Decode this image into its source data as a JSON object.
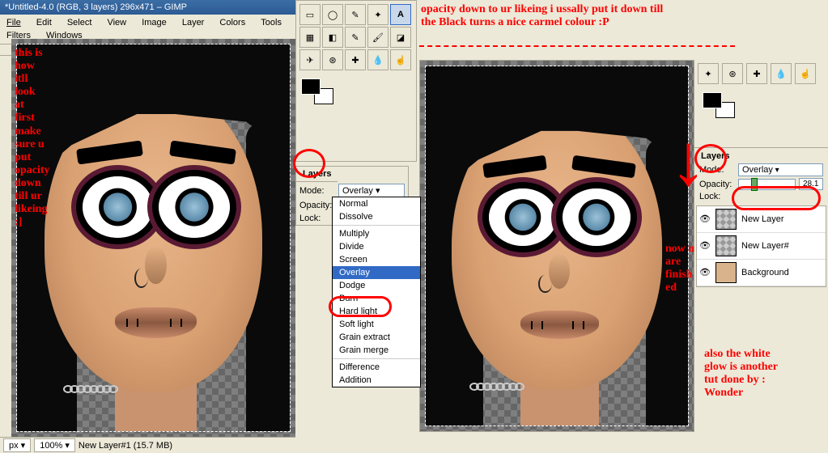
{
  "window": {
    "title": "*Untitled-4.0 (RGB, 3 layers) 296x471 – GIMP"
  },
  "menubar": {
    "items": [
      "File",
      "Edit",
      "Select",
      "View",
      "Image",
      "Layer",
      "Colors",
      "Tools",
      "Filters",
      "Windows"
    ]
  },
  "statusbar": {
    "unit": "px",
    "zoom": "100%",
    "layer": "New Layer#1 (15.7 MB)"
  },
  "layers_mid": {
    "tab": "Layers",
    "mode_label": "Mode:",
    "mode_value": "Overlay",
    "opacity_label": "Opacity:",
    "lock_label": "Lock:"
  },
  "mode_options": [
    "Normal",
    "Dissolve",
    "",
    "Multiply",
    "Divide",
    "Screen",
    "Overlay",
    "Dodge",
    "Burn",
    "Hard light",
    "Soft light",
    "Grain extract",
    "Grain merge",
    "",
    "Difference",
    "Addition"
  ],
  "layers_far": {
    "tab": "Layers",
    "mode_label": "Mode:",
    "mode_value": "Overlay",
    "opacity_label": "Opacity:",
    "opacity_value": "28.1",
    "lock_label": "Lock:",
    "items": [
      {
        "name": "New Layer"
      },
      {
        "name": "New Layer#"
      },
      {
        "name": "Background"
      }
    ]
  },
  "annotations": {
    "left": "this is\nhow\nitll\nlook\nat\nfirst\nmake\nsure u\nput\nopacity\ndown\ntill ur\nlikeing\n:]",
    "top_right": "opacity down to ur likeing i ussally put it down till\nthe Black turns a nice carmel colour :P",
    "finished": "now u\nare\nfinish\ned",
    "credit": "also the white\nglow is another\ntut done by :\nWonder"
  }
}
